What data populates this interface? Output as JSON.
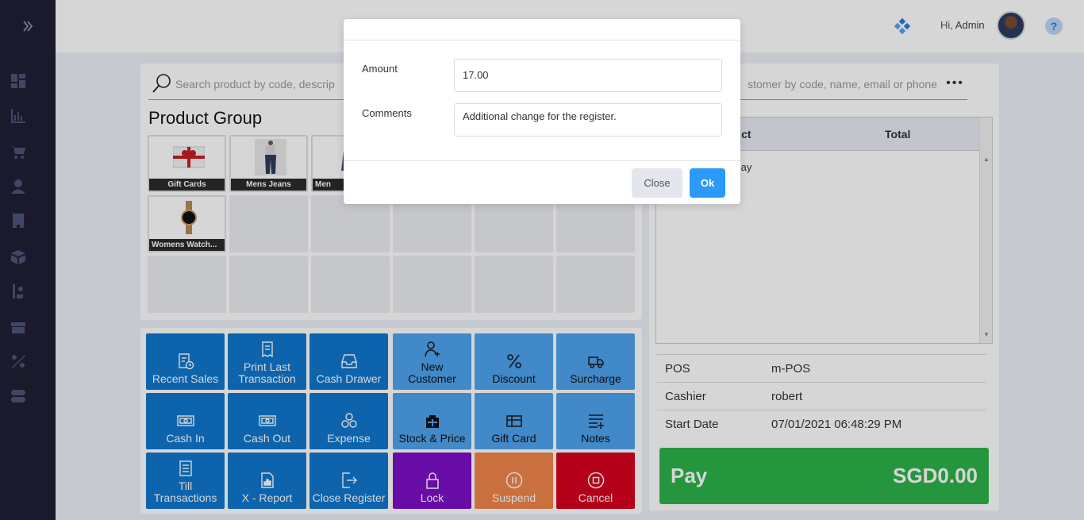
{
  "header": {
    "greeting_prefix": "Hi,",
    "user_name": "Admin",
    "help_label": "?"
  },
  "search": {
    "product_placeholder": "Search product by code, descrip",
    "customer_placeholder": "stomer by code, name, email or phone",
    "more_label": "•••"
  },
  "product_group": {
    "title": "Product Group",
    "items": [
      {
        "label": "Gift Cards"
      },
      {
        "label": "Mens Jeans"
      },
      {
        "label": "Men"
      },
      {
        "label": "Womens Watch..."
      }
    ]
  },
  "cart": {
    "col_product": "duct",
    "col_total": "Total",
    "empty_text": "splay"
  },
  "register_info": {
    "rows": [
      {
        "key": "POS",
        "value": "m-POS"
      },
      {
        "key": "Cashier",
        "value": "robert"
      },
      {
        "key": "Start Date",
        "value": "07/01/2021 06:48:29 PM"
      }
    ]
  },
  "pay": {
    "label": "Pay",
    "amount": "SGD0.00"
  },
  "actions": [
    {
      "label": "Recent Sales",
      "icon": "recent-sales-icon",
      "color": "blue"
    },
    {
      "label": "Print Last\nTransaction",
      "icon": "print-icon",
      "color": "blue"
    },
    {
      "label": "Cash Drawer",
      "icon": "drawer-icon",
      "color": "blue"
    },
    {
      "label": "New\nCustomer",
      "icon": "add-user-icon",
      "color": "lblue"
    },
    {
      "label": "Discount",
      "icon": "percent-icon",
      "color": "lblue"
    },
    {
      "label": "Surcharge",
      "icon": "truck-icon",
      "color": "lblue"
    },
    {
      "label": "Cash In",
      "icon": "cash-in-icon",
      "color": "blue"
    },
    {
      "label": "Cash Out",
      "icon": "cash-out-icon",
      "color": "blue"
    },
    {
      "label": "Expense",
      "icon": "coins-icon",
      "color": "blue"
    },
    {
      "label": "Stock & Price",
      "icon": "stock-icon",
      "color": "lblue"
    },
    {
      "label": "Gift Card",
      "icon": "gift-card-icon",
      "color": "lblue"
    },
    {
      "label": "Notes",
      "icon": "notes-icon",
      "color": "lblue"
    },
    {
      "label": "Till\nTransactions",
      "icon": "till-icon",
      "color": "blue"
    },
    {
      "label": "X - Report",
      "icon": "report-icon",
      "color": "blue"
    },
    {
      "label": "Close Register",
      "icon": "logout-icon",
      "color": "blue"
    },
    {
      "label": "Lock",
      "icon": "lock-icon",
      "color": "purple"
    },
    {
      "label": "Suspend",
      "icon": "pause-icon",
      "color": "orange"
    },
    {
      "label": "Cancel",
      "icon": "stop-icon",
      "color": "red"
    }
  ],
  "modal": {
    "amount_label": "Amount",
    "amount_value": "17.00",
    "comments_label": "Comments",
    "comments_value": "Additional change for the register.",
    "close_label": "Close",
    "ok_label": "Ok"
  },
  "colors": {
    "sidebar": "#1f2035",
    "blue": "#1078ce",
    "light_blue": "#4ea4ef",
    "purple": "#7d0fc7",
    "orange": "#f0864a",
    "red": "#d8001f",
    "pay_green": "#2db34a",
    "ok_blue": "#2c9af8"
  }
}
